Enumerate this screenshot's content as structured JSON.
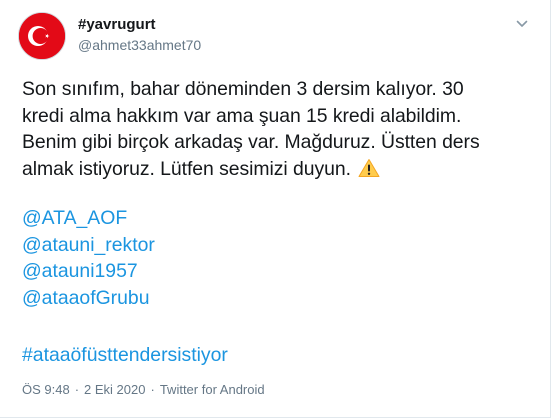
{
  "tweet": {
    "display_name": "#yavrugurt",
    "handle": "@ahmet33ahmet70",
    "body": "Son sınıfım, bahar döneminden 3 dersim kalıyor. 30\nkredi alma hakkım var ama şuan 15 kredi alabildim.\nBenim gibi birçok arkadaş var.  Mağduruz.  Üstten ders\nalmak istiyoruz.  Lütfen sesimizi duyun. ",
    "warning_icon": "warning-sign-icon",
    "mentions": [
      "@ATA_AOF",
      "@atauni_rektor",
      "@atauni1957",
      "@ataaofGrubu"
    ],
    "hashtag": "#ataaöfüsttendersistiyor",
    "time": "ÖS 9:48",
    "date": "2 Eki 2020",
    "source": "Twitter for Android",
    "separator": "·"
  },
  "icons": {
    "avatar": "turkish-flag-avatar",
    "menu": "chevron-down-icon"
  },
  "colors": {
    "link": "#1b95e0",
    "text": "#14171a",
    "muted": "#657786",
    "flag_red": "#e30a17"
  }
}
